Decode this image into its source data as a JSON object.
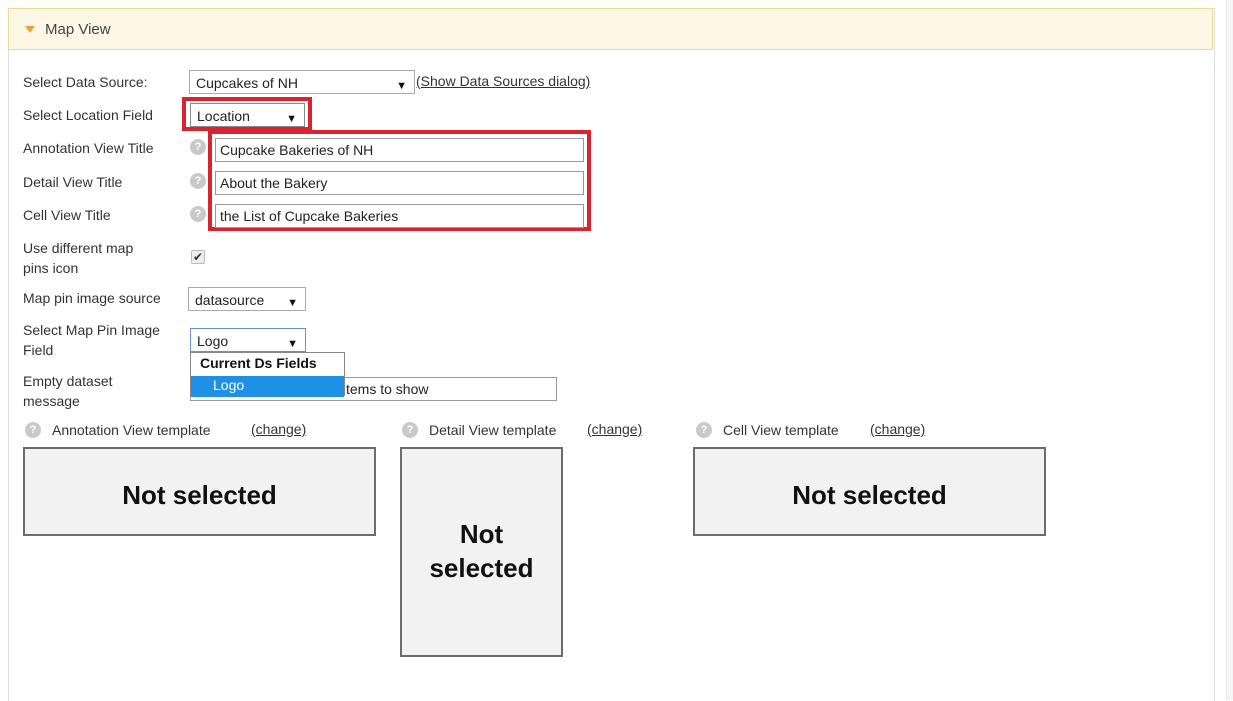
{
  "panel": {
    "title": "Map View"
  },
  "form": {
    "data_source": {
      "label": "Select Data Source:",
      "value": "Cupcakes of NH",
      "link": "(Show Data Sources dialog)"
    },
    "location_field": {
      "label": "Select Location Field",
      "value": "Location"
    },
    "annotation_title": {
      "label": "Annotation View Title",
      "value": "Cupcake Bakeries of NH"
    },
    "detail_title": {
      "label": "Detail View Title",
      "value": "About the Bakery"
    },
    "cell_title": {
      "label": "Cell View Title",
      "value": "the List of Cupcake Bakeries"
    },
    "different_pins": {
      "label_line1": "Use different map",
      "label_line2": "pins icon",
      "checked": true
    },
    "pin_source": {
      "label": "Map pin image source",
      "value": "datasource"
    },
    "pin_field": {
      "label_line1": "Select Map Pin Image",
      "label_line2": "Field",
      "value": "Logo",
      "dropdown": {
        "group": "Current Ds Fields",
        "options": [
          "Logo"
        ]
      }
    },
    "empty_message": {
      "label_line1": "Empty dataset",
      "label_line2": "message",
      "value_visible": "tems to show"
    }
  },
  "templates": {
    "annotation": {
      "label": "Annotation View template",
      "link": "(change)",
      "status": "Not selected"
    },
    "detail": {
      "label": "Detail View template",
      "link": "(change)",
      "status_line1": "Not",
      "status_line2": "selected"
    },
    "cell": {
      "label": "Cell View template",
      "link": "(change)",
      "status": "Not selected"
    }
  },
  "colors": {
    "highlight": "#d9232e",
    "header_bg": "#fdf8e6",
    "selected_option": "#1e90e6"
  },
  "icons": [
    "caret-down-icon",
    "help-icon",
    "checkmark-icon",
    "dropdown-arrow-icon"
  ]
}
